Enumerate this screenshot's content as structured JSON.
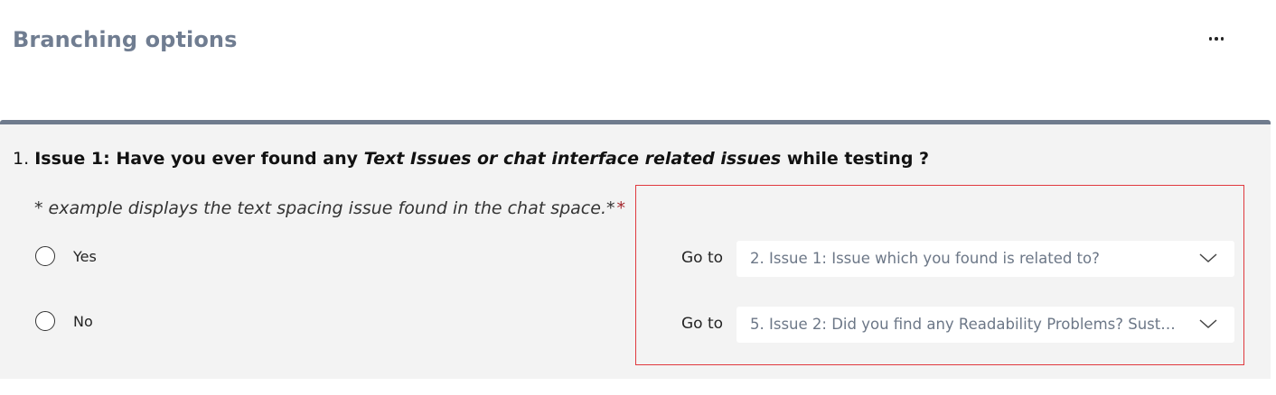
{
  "header": {
    "title": "Branching options",
    "more_icon": "more-horizontal-icon"
  },
  "question": {
    "number": "1.",
    "title_prefix": "Issue 1:",
    "title_part1": " Have you ever found any ",
    "title_italic": "Text Issues or chat interface related issues",
    "title_part2": " while testing ?",
    "subtitle": "* example displays the text spacing issue found in the chat space.*",
    "required_mark": "*",
    "options": [
      {
        "label": "Yes",
        "selected": false
      },
      {
        "label": "No",
        "selected": false
      }
    ]
  },
  "branching": {
    "highlight_color": "#e0393e",
    "rows": [
      {
        "label": "Go to",
        "target": "2. Issue 1: Issue which you found is related to?"
      },
      {
        "label": "Go to",
        "target": "5. Issue 2: Did you find any Readability Problems?  Sustai..."
      }
    ]
  },
  "colors": {
    "accent_bar": "#6f7b8d",
    "title_color": "#707d91",
    "card_background": "#f3f3f3"
  }
}
